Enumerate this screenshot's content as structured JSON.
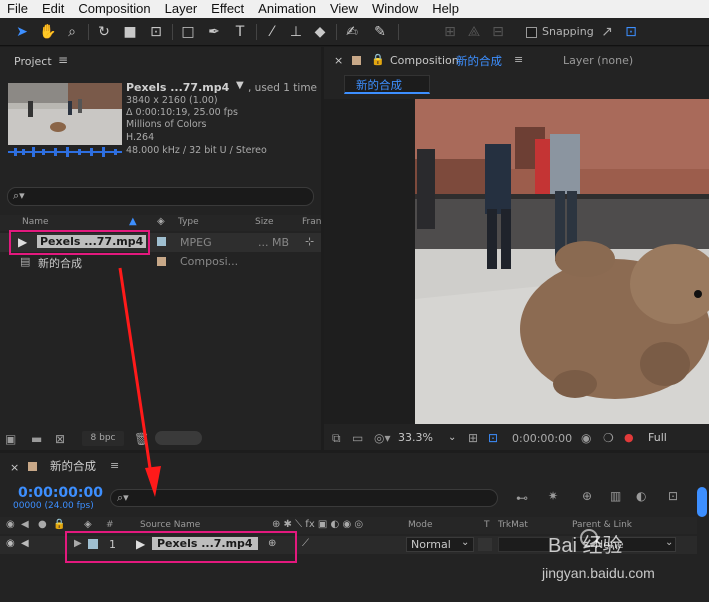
{
  "menu": [
    "File",
    "Edit",
    "Composition",
    "Layer",
    "Effect",
    "Animation",
    "View",
    "Window",
    "Help"
  ],
  "toolbar": {
    "snapping_label": "Snapping"
  },
  "project": {
    "tab_label": "Project",
    "file_name": "Pexels ...77.mp4",
    "used_text": ", used 1 time",
    "meta": [
      "3840 x 2160 (1.00)",
      "Δ 0:00:10:19, 25.00 fps",
      "Millions of Colors",
      "H.264",
      "48.000 kHz / 32 bit U / Stereo"
    ],
    "columns": {
      "name": "Name",
      "type": "Type",
      "size": "Size",
      "frame": "Fran"
    },
    "items": [
      {
        "name": "Pexels ...77.mp4",
        "type": "MPEG",
        "size": "... MB",
        "label_color": "#9fbfd0"
      },
      {
        "name": "新的合成",
        "type": "Composi...",
        "size": "",
        "label_color": "#c8a888"
      }
    ],
    "bpc": "8 bpc"
  },
  "composition": {
    "tab_prefix": "Composition",
    "tab_name": "新的合成",
    "layer_tab": "Layer (none)",
    "subtab": "新的合成",
    "zoom": "33.3%",
    "timecode": "0:00:00:00",
    "resolution": "Full"
  },
  "timeline": {
    "tab_name": "新的合成",
    "timecode": "0:00:00:00",
    "frame_info": "00000 (24.00 fps)",
    "columns": {
      "num": "#",
      "source": "Source Name",
      "mode": "Mode",
      "t": "T",
      "trkmat": "TrkMat",
      "parent": "Parent & Link"
    },
    "layer": {
      "index": "1",
      "name": "Pexels ...7.mp4",
      "mode": "Normal",
      "parent": "None"
    }
  },
  "watermark": {
    "brand": "Bai  经验",
    "url": "jingyan.baidu.com"
  }
}
